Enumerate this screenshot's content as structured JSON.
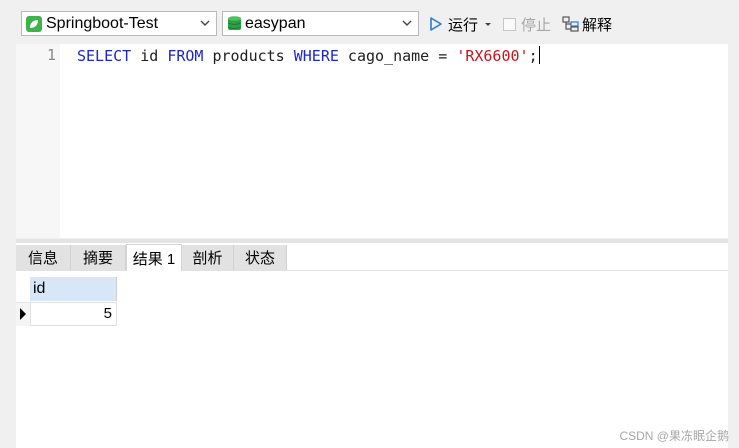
{
  "toolbar": {
    "connection": "Springboot-Test",
    "database": "easypan",
    "run_label": "运行",
    "stop_label": "停止",
    "explain_label": "解释"
  },
  "editor": {
    "line_number": "1",
    "tokens": {
      "select": "SELECT",
      "col": " id ",
      "from": "FROM",
      "table": " products ",
      "where": "WHERE",
      "cond": " cago_name = ",
      "value": "'RX6600'",
      "end": ";"
    }
  },
  "result_tabs": [
    "信息",
    "摘要",
    "结果 1",
    "剖析",
    "状态"
  ],
  "grid": {
    "column": "id",
    "rows": [
      "5"
    ]
  },
  "watermark": "CSDN @果冻眠企鹅",
  "colors": {
    "keyword": "#1d27c9",
    "string": "#c8141b",
    "connection_icon": "#3db34a",
    "database_icon": "#2f9e44"
  }
}
